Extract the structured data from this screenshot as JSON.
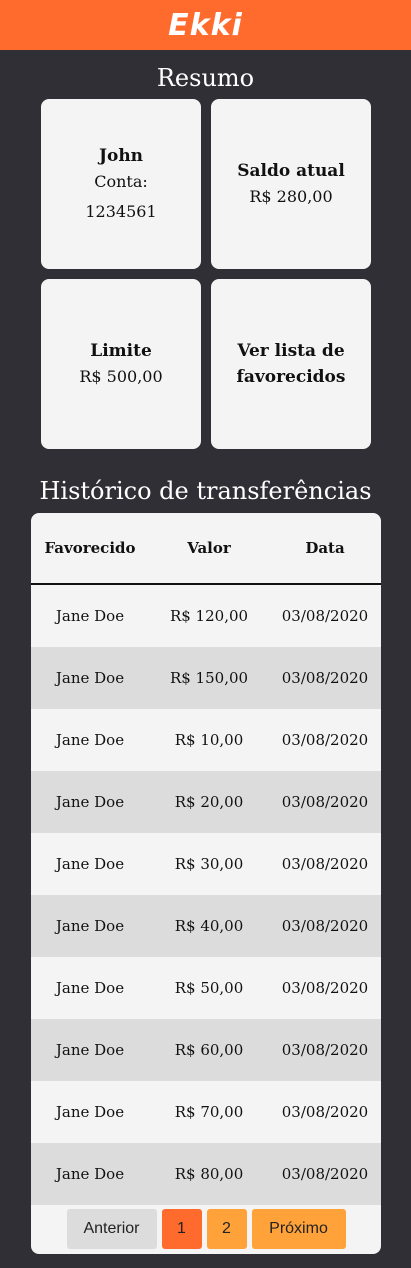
{
  "header": {
    "logo": "Ekki"
  },
  "summary": {
    "title": "Resumo",
    "account": {
      "name": "John",
      "label": "Conta:",
      "number": "1234561"
    },
    "balance": {
      "label": "Saldo atual",
      "value": "R$ 280,00"
    },
    "limit": {
      "label": "Limite",
      "value": "R$ 500,00"
    },
    "favorites": {
      "line1": "Ver lista de",
      "line2": "favorecidos"
    }
  },
  "history": {
    "title": "Histórico de transferências",
    "columns": [
      "Favorecido",
      "Valor",
      "Data"
    ],
    "rows": [
      [
        "Jane Doe",
        "R$ 120,00",
        "03/08/2020"
      ],
      [
        "Jane Doe",
        "R$ 150,00",
        "03/08/2020"
      ],
      [
        "Jane Doe",
        "R$ 10,00",
        "03/08/2020"
      ],
      [
        "Jane Doe",
        "R$ 20,00",
        "03/08/2020"
      ],
      [
        "Jane Doe",
        "R$ 30,00",
        "03/08/2020"
      ],
      [
        "Jane Doe",
        "R$ 40,00",
        "03/08/2020"
      ],
      [
        "Jane Doe",
        "R$ 50,00",
        "03/08/2020"
      ],
      [
        "Jane Doe",
        "R$ 60,00",
        "03/08/2020"
      ],
      [
        "Jane Doe",
        "R$ 70,00",
        "03/08/2020"
      ],
      [
        "Jane Doe",
        "R$ 80,00",
        "03/08/2020"
      ]
    ]
  },
  "pagination": {
    "prev": "Anterior",
    "page1": "1",
    "page2": "2",
    "next": "Próximo"
  },
  "colors": {
    "brand": "#ff6b2c",
    "accent": "#ffa23a",
    "background": "#312f36"
  }
}
